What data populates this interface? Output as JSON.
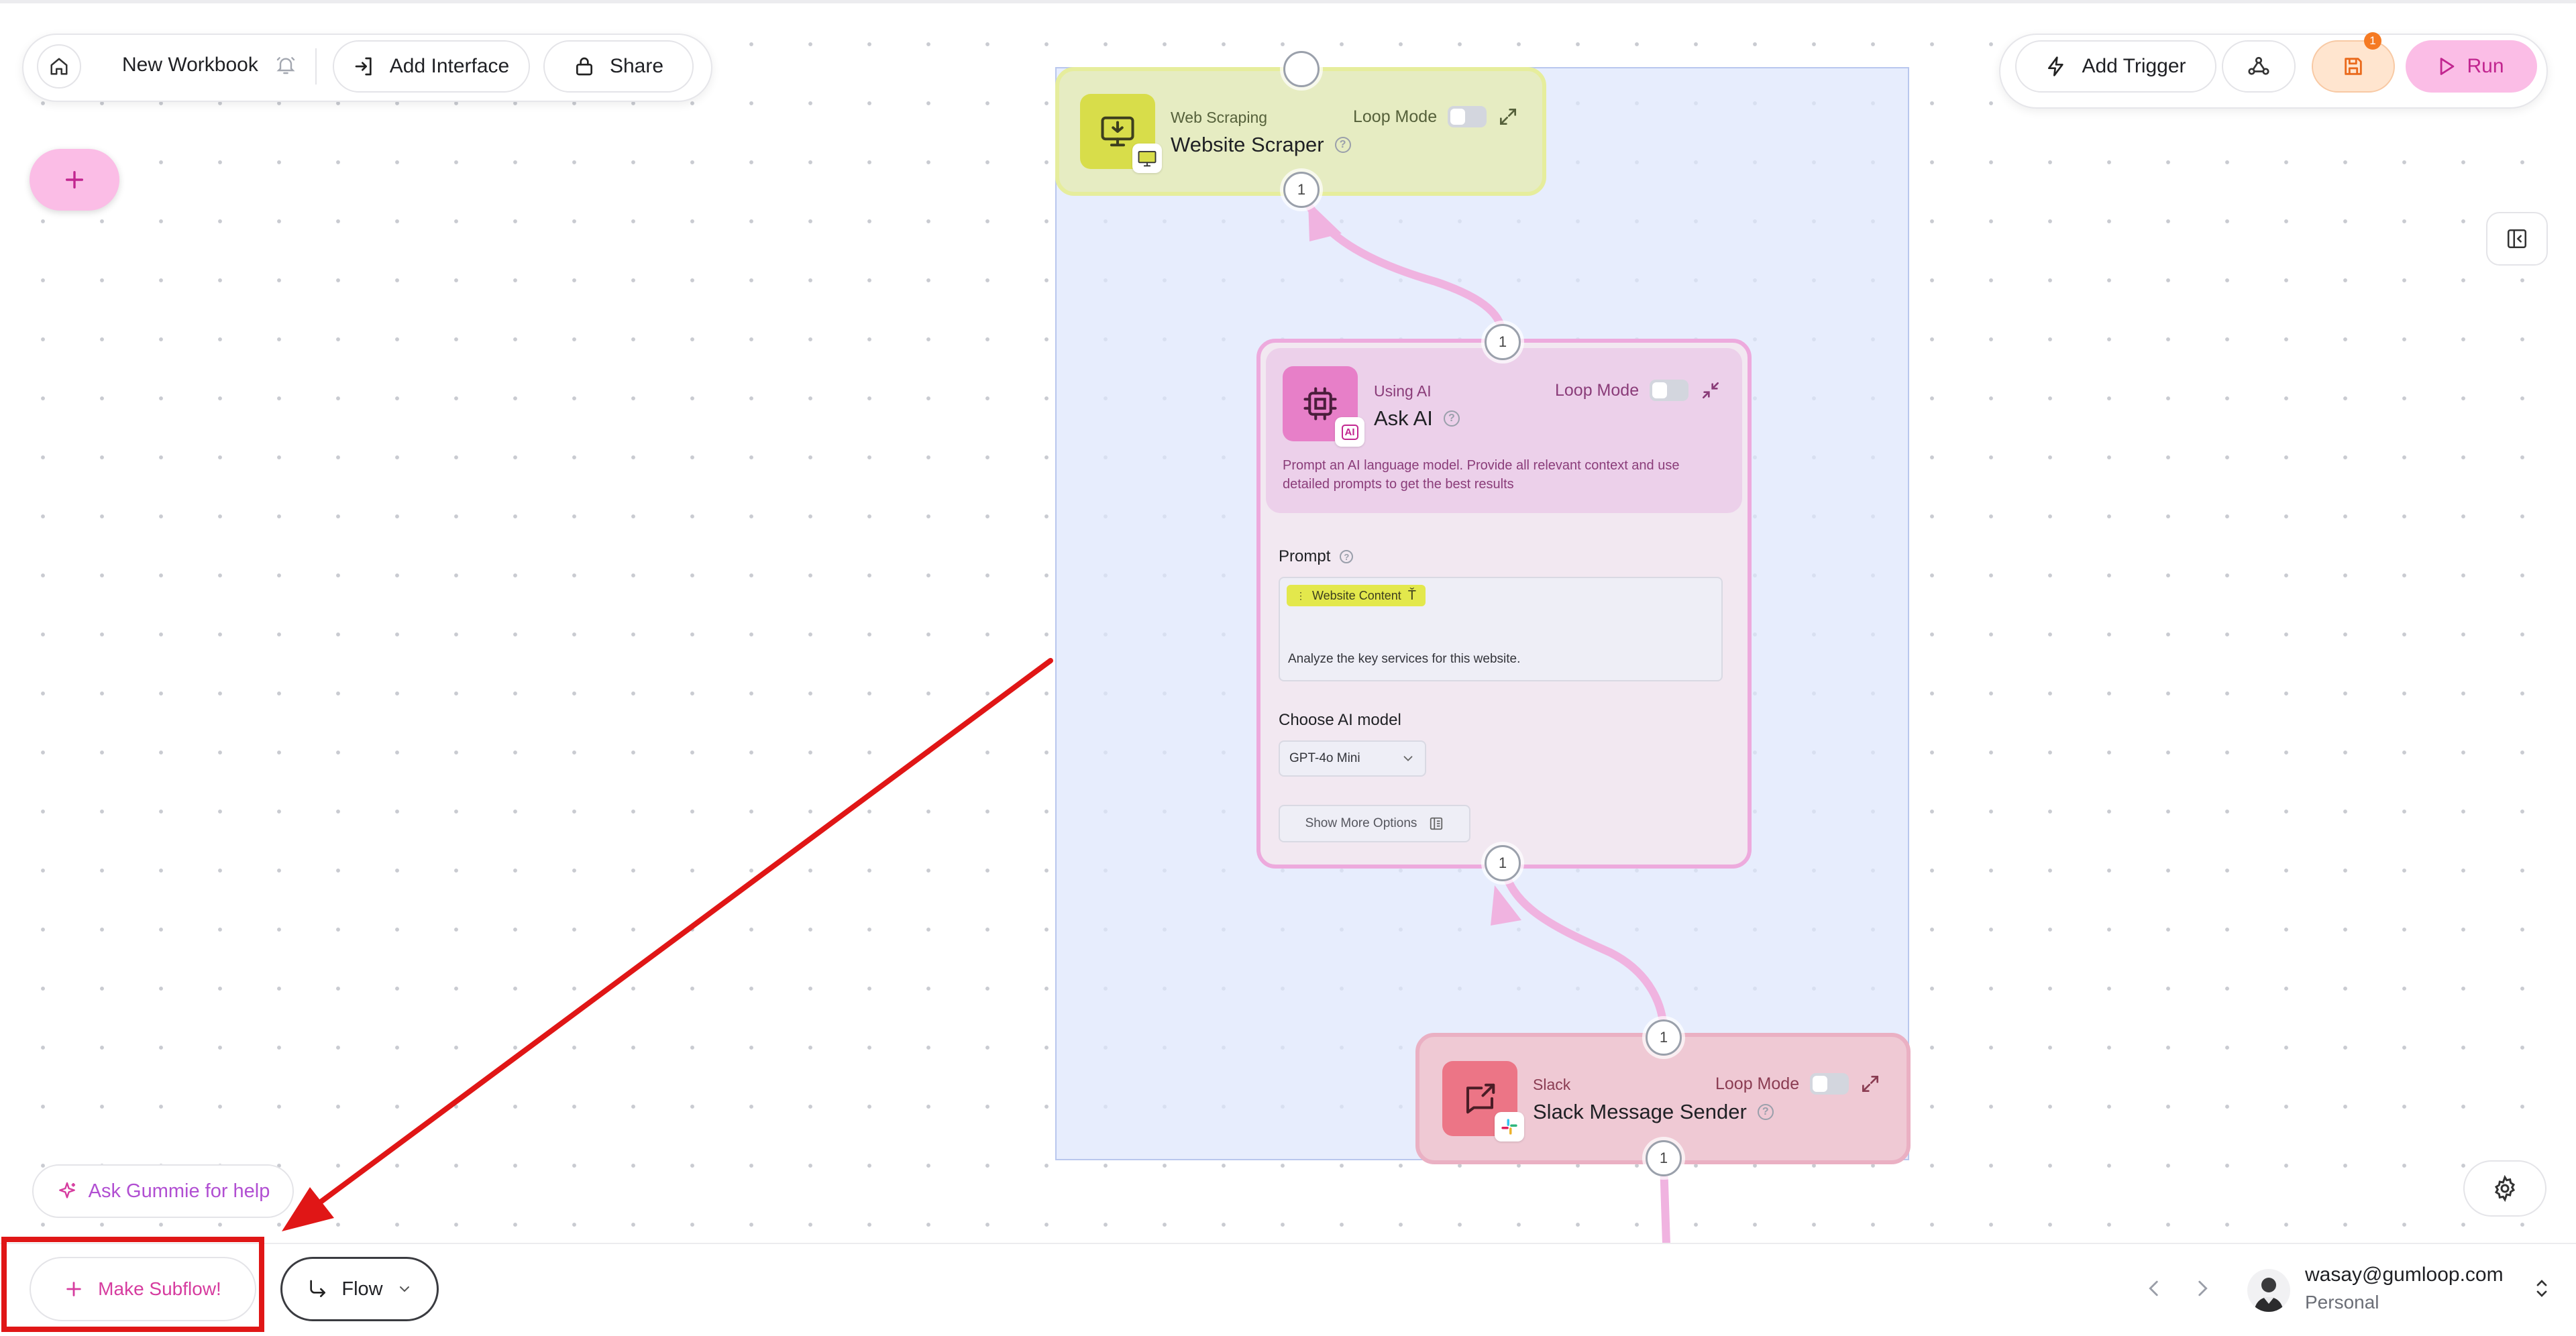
{
  "toolbar": {
    "workbook_name": "New Workbook",
    "add_interface": "Add Interface",
    "share": "Share",
    "add_trigger": "Add Trigger",
    "run": "Run",
    "save_badge_count": "1"
  },
  "nodes": {
    "scraper": {
      "category": "Web Scraping",
      "title": "Website Scraper",
      "loop_mode": "Loop Mode",
      "out_handle": "1"
    },
    "ask_ai": {
      "category": "Using AI",
      "title": "Ask AI",
      "loop_mode": "Loop Mode",
      "badge": "AI",
      "description": "Prompt an AI language model. Provide all relevant context and use detailed prompts to get the best results",
      "prompt_label": "Prompt",
      "prompt_chip": "Website Content",
      "prompt_text": "Analyze the key services for this website.",
      "model_label": "Choose AI model",
      "model_value": "GPT-4o Mini",
      "show_more": "Show More Options",
      "in_handle": "1",
      "out_handle": "1"
    },
    "slack": {
      "category": "Slack",
      "title": "Slack Message Sender",
      "loop_mode": "Loop Mode",
      "in_handle": "1",
      "out_handle": "1"
    }
  },
  "bottom": {
    "ask_gummie": "Ask Gummie for help",
    "make_subflow": "Make Subflow!",
    "flow": "Flow",
    "user_email": "wasay@gumloop.com",
    "user_workspace": "Personal"
  },
  "colors": {
    "accent_pink": "#d63c9f",
    "run_bg": "#fbbde6",
    "annotation_red": "#e01616",
    "scraper_bg": "#e6ecc2",
    "ai_bg": "#ecd0ea",
    "slack_bg": "#efc9d4"
  }
}
